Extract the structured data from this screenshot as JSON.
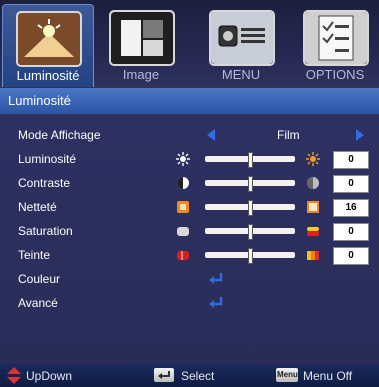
{
  "tabs": [
    {
      "label": "Luminosité",
      "icon": "brightness-tab-icon",
      "active": true
    },
    {
      "label": "Image",
      "icon": "image-tab-icon",
      "active": false
    },
    {
      "label": "MENU",
      "icon": "menu-tab-icon",
      "active": false
    },
    {
      "label": "OPTIONS",
      "icon": "options-tab-icon",
      "active": false
    }
  ],
  "section_title": "Luminosité",
  "rows": {
    "mode": {
      "label": "Mode Affichage",
      "value": "Film"
    },
    "brightness": {
      "label": "Luminosité",
      "value": "0",
      "level": 0.5
    },
    "contrast": {
      "label": "Contraste",
      "value": "0",
      "level": 0.5
    },
    "sharpness": {
      "label": "Netteté",
      "value": "16",
      "level": 0.5
    },
    "saturation": {
      "label": "Saturation",
      "value": "0",
      "level": 0.5
    },
    "tint": {
      "label": "Teinte",
      "value": "0",
      "level": 0.5
    },
    "color": {
      "label": "Couleur"
    },
    "advanced": {
      "label": "Avancé"
    }
  },
  "footer": {
    "updown": "UpDown",
    "select": "Select",
    "menu_key": "Menu",
    "menu_off": "Menu Off"
  },
  "colors": {
    "accent": "#2f6de0",
    "title_bar": "#3a66b8",
    "background": "#2a2c56"
  }
}
